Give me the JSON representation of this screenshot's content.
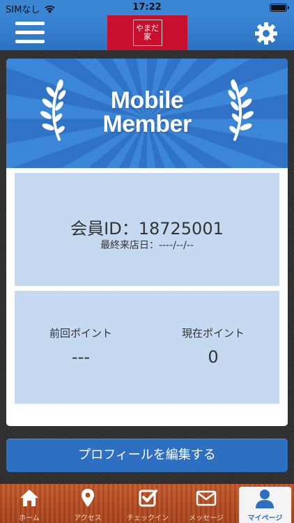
{
  "status_bar": {
    "carrier": "SIMなし",
    "time": "17:22"
  },
  "header": {
    "menu_icon": "hamburger-menu-icon",
    "logo_text": "やまだ家",
    "settings_icon": "gear-icon"
  },
  "card": {
    "banner_title_line1": "Mobile",
    "banner_title_line2": "Member",
    "member_id": "会員ID：18725001",
    "last_visit": "最終来店日：----/--/--",
    "points": {
      "previous_label": "前回ポイント",
      "previous_value": "---",
      "current_label": "現在ポイント",
      "current_value": "0"
    }
  },
  "edit_profile_label": "プロフィールを編集する",
  "tabs": [
    {
      "label": "ホーム",
      "icon": "home-icon"
    },
    {
      "label": "アクセス",
      "icon": "map-pin-icon"
    },
    {
      "label": "チェックイン",
      "icon": "checkbox-icon"
    },
    {
      "label": "メッセージ",
      "icon": "mail-icon"
    },
    {
      "label": "マイページ",
      "icon": "person-icon",
      "active": true
    }
  ],
  "colors": {
    "brand_blue": "#2d6fc0",
    "logo_red": "#c8102e",
    "panel_blue": "#c5d9f0",
    "tabbar_orange": "#b84c22"
  }
}
